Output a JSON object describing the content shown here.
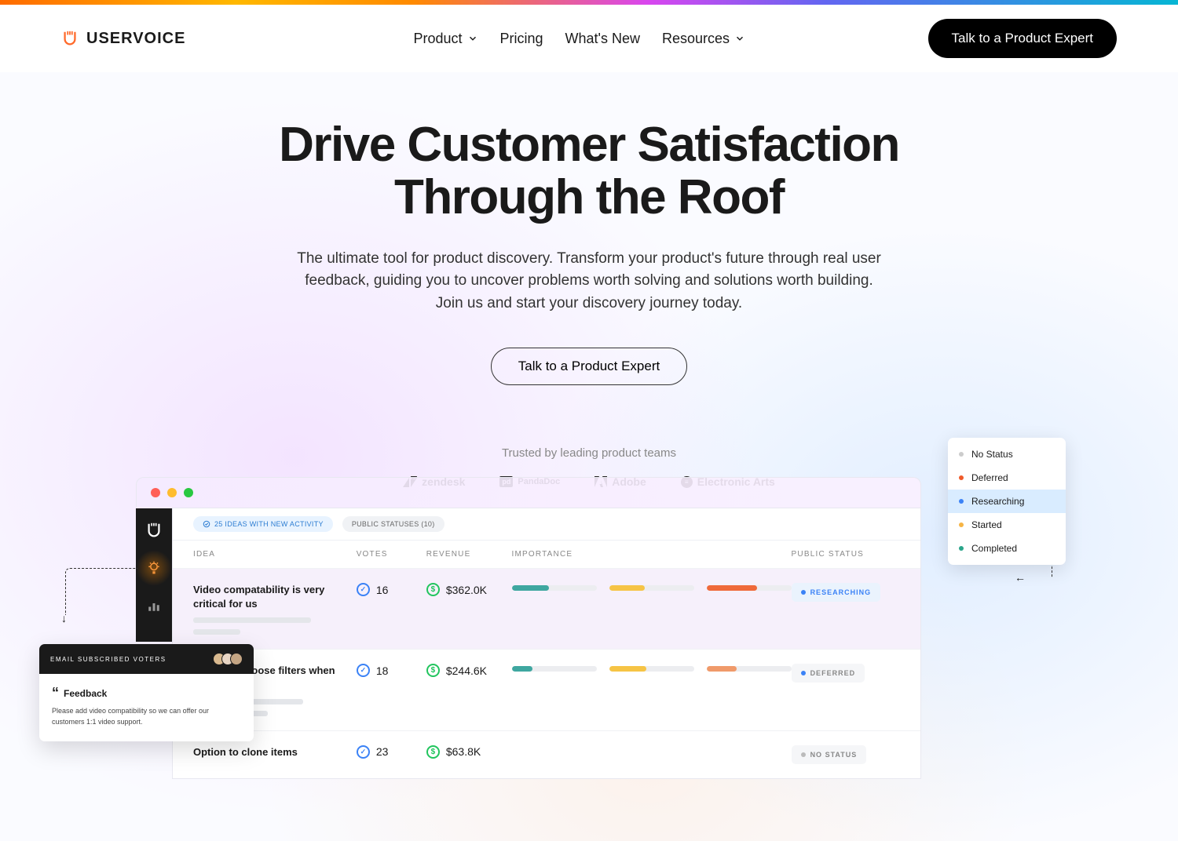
{
  "brand": "USERVOICE",
  "nav": {
    "items": [
      "Product",
      "Pricing",
      "What's New",
      "Resources"
    ],
    "has_dropdown": [
      true,
      false,
      false,
      true
    ]
  },
  "cta_primary": "Talk to a Product Expert",
  "hero": {
    "title_line1": "Drive Customer Satisfaction",
    "title_line2": "Through the Roof",
    "subtitle": "The ultimate tool for product discovery. Transform your product's future through real user feedback, guiding you to uncover problems worth solving and solutions worth building. Join us and start your discovery journey today.",
    "cta": "Talk to a Product Expert"
  },
  "trusted": {
    "label": "Trusted by leading product teams",
    "logos": [
      "zendesk",
      "PandaDoc",
      "Adobe",
      "Electronic Arts"
    ]
  },
  "filters": {
    "activity": "25 IDEAS WITH NEW ACTIVITY",
    "statuses": "PUBLIC STATUSES (10)"
  },
  "table": {
    "headers": [
      "IDEA",
      "VOTES",
      "REVENUE",
      "IMPORTANCE",
      "PUBLIC STATUS"
    ],
    "rows": [
      {
        "idea": "Video compatability is very critical for us",
        "votes": "16",
        "revenue": "$362.0K",
        "bars": [
          {
            "fill": 44,
            "color": "#3fa7a0"
          },
          {
            "fill": 42,
            "color": "#f6c445"
          },
          {
            "fill": 60,
            "color": "#ef6a3a"
          }
        ],
        "status": "RESEARCHING",
        "status_dot": "#3b82f6",
        "highlighted": true
      },
      {
        "idea": "Ability to choose filters when searching",
        "idea_clipped": "y to choose filters\nhing",
        "votes": "18",
        "revenue": "$244.6K",
        "bars": [
          {
            "fill": 24,
            "color": "#3fa7a0"
          },
          {
            "fill": 44,
            "color": "#f6c445"
          },
          {
            "fill": 36,
            "color": "#f09a6a"
          }
        ],
        "status": "DEFERRED",
        "status_dot": "#3b82f6"
      },
      {
        "idea": "Option to clone items",
        "idea_clipped": "to clone items",
        "votes": "23",
        "revenue": "$63.8K",
        "bars": [],
        "status": "NO STATUS",
        "status_dot": "#bbb"
      }
    ]
  },
  "status_menu": [
    {
      "label": "No Status",
      "color": "#ccc"
    },
    {
      "label": "Deferred",
      "color": "#ef5a2a"
    },
    {
      "label": "Researching",
      "color": "#3b82f6",
      "selected": true
    },
    {
      "label": "Started",
      "color": "#f6b445"
    },
    {
      "label": "Completed",
      "color": "#2aa58a"
    }
  ],
  "feedback_popup": {
    "header": "EMAIL SUBSCRIBED VOTERS",
    "title": "Feedback",
    "body": "Please add video compatibility so we can offer our customers 1:1 video support."
  }
}
